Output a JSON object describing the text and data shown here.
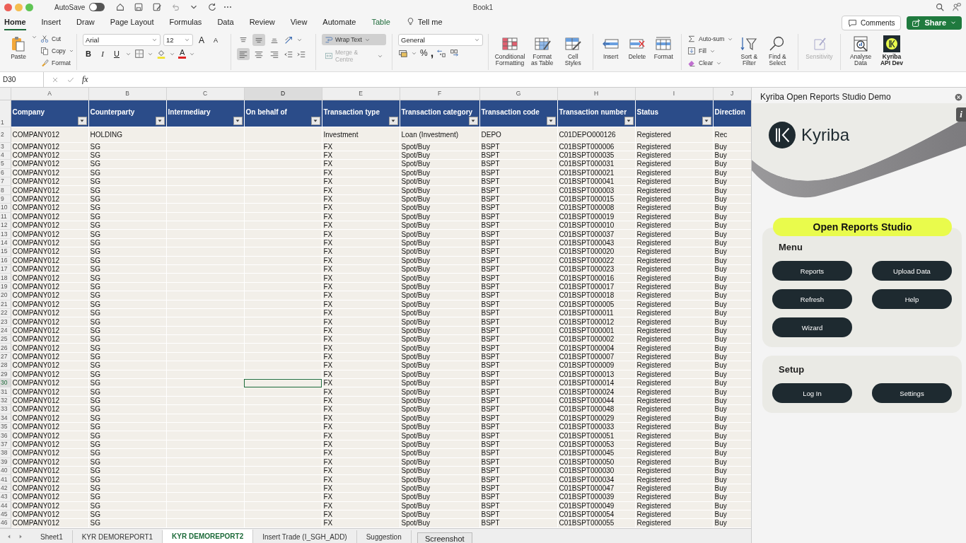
{
  "title_bar": {
    "autosave_label": "AutoSave",
    "autosave_on": false,
    "more": "⋯",
    "title": "Book1"
  },
  "ribbon_tabs": [
    {
      "label": "Home",
      "selected": true,
      "kind": "tab"
    },
    {
      "label": "Insert",
      "selected": false,
      "kind": "tab"
    },
    {
      "label": "Draw",
      "selected": false,
      "kind": "tab"
    },
    {
      "label": "Page Layout",
      "selected": false,
      "kind": "tab"
    },
    {
      "label": "Formulas",
      "selected": false,
      "kind": "tab"
    },
    {
      "label": "Data",
      "selected": false,
      "kind": "tab"
    },
    {
      "label": "Review",
      "selected": false,
      "kind": "tab"
    },
    {
      "label": "View",
      "selected": false,
      "kind": "tab"
    },
    {
      "label": "Automate",
      "selected": false,
      "kind": "tab"
    },
    {
      "label": "Table",
      "selected": false,
      "kind": "contextual"
    },
    {
      "label": "Tell me",
      "selected": false,
      "kind": "search"
    }
  ],
  "comments_button": "Comments",
  "share_button": "Share",
  "ribbon": {
    "clipboard": {
      "paste": "Paste",
      "items": [
        {
          "label": "Cut",
          "kind": "cut",
          "menu": false
        },
        {
          "label": "Copy",
          "kind": "copy",
          "menu": true
        },
        {
          "label": "Format",
          "kind": "brush",
          "menu": false
        }
      ]
    },
    "font": {
      "name": "Arial",
      "size": "12",
      "grow": "A",
      "shrink": "A",
      "styles": [
        "B",
        "I",
        "U"
      ],
      "color_letter": "A"
    },
    "alignment": {
      "vertical": [
        {
          "kind": "top",
          "selected": false
        },
        {
          "kind": "middle",
          "selected": true
        },
        {
          "kind": "bottom",
          "selected": false
        }
      ],
      "horizontal": [
        {
          "kind": "left",
          "selected": true
        },
        {
          "kind": "center",
          "selected": false
        },
        {
          "kind": "right",
          "selected": false
        }
      ]
    },
    "wrap": {
      "label": "Wrap Text",
      "on": true
    },
    "merge": {
      "label": "Merge & Centre",
      "disabled": true
    },
    "number": {
      "format": "General",
      "percent": "%",
      "comma": ","
    },
    "styles": [
      {
        "label": "Conditional\nFormatting",
        "kind": "conditional"
      },
      {
        "label": "Format\nas Table",
        "kind": "table"
      },
      {
        "label": "Cell\nStyles",
        "kind": "cellstyles"
      }
    ],
    "cells": [
      {
        "label": "Insert",
        "kind": "insert"
      },
      {
        "label": "Delete",
        "kind": "delete"
      },
      {
        "label": "Format",
        "kind": "formatcells"
      }
    ],
    "editing_small": [
      {
        "label": "Auto-sum",
        "kind": "sum"
      },
      {
        "label": "Fill",
        "kind": "filldown"
      },
      {
        "label": "Clear",
        "kind": "eraser"
      }
    ],
    "editing_big": [
      {
        "label": "Sort &\nFilter",
        "kind": "sort"
      },
      {
        "label": "Find &\nSelect",
        "kind": "find"
      }
    ],
    "sensitivity": {
      "label": "Sensitivity",
      "disabled": true
    },
    "addins": [
      {
        "label": "Analyse\nData",
        "kind": "analyse"
      },
      {
        "label": "Kyriba\nAPI Dev",
        "kind": "kyriba"
      }
    ]
  },
  "formula_bar": {
    "name_box": "D30",
    "fx": "fx"
  },
  "sheet": {
    "header_row_number": "1",
    "columns": [
      {
        "letter": "A",
        "label": "Company",
        "selected": false,
        "filter_button": true
      },
      {
        "letter": "B",
        "label": "Counterparty",
        "selected": false,
        "filter_button": true
      },
      {
        "letter": "C",
        "label": "Intermediary",
        "selected": false,
        "filter_button": true
      },
      {
        "letter": "D",
        "label": "On behalf of",
        "selected": true,
        "filter_button": true
      },
      {
        "letter": "E",
        "label": "Transaction type",
        "selected": false,
        "filter_button": true
      },
      {
        "letter": "F",
        "label": "Transaction category",
        "selected": false,
        "filter_button": true
      },
      {
        "letter": "G",
        "label": "Transaction code",
        "selected": false,
        "filter_button": true
      },
      {
        "letter": "H",
        "label": "Transaction number",
        "selected": false,
        "filter_button": true
      },
      {
        "letter": "I",
        "label": "Status",
        "selected": false,
        "filter_button": true
      },
      {
        "letter": "J",
        "label": "Direction",
        "selected": false,
        "filter_button": false
      }
    ],
    "rows": [
      {
        "number": "2",
        "selected": false,
        "cells": [
          "COMPANY012",
          "HOLDING",
          null,
          null,
          "Investment",
          "Loan (Investment)",
          "DEPO",
          "C01DEPO000126",
          "Registered",
          "Rec"
        ]
      },
      {
        "number": "3",
        "selected": false,
        "cells": [
          "COMPANY012",
          "SG",
          null,
          null,
          "FX",
          "Spot/Buy",
          "BSPT",
          "C01BSPT000006",
          "Registered",
          "Buy"
        ]
      },
      {
        "number": "4",
        "selected": false,
        "cells": [
          "COMPANY012",
          "SG",
          null,
          null,
          "FX",
          "Spot/Buy",
          "BSPT",
          "C01BSPT000035",
          "Registered",
          "Buy"
        ]
      },
      {
        "number": "5",
        "selected": false,
        "cells": [
          "COMPANY012",
          "SG",
          null,
          null,
          "FX",
          "Spot/Buy",
          "BSPT",
          "C01BSPT000031",
          "Registered",
          "Buy"
        ]
      },
      {
        "number": "6",
        "selected": false,
        "cells": [
          "COMPANY012",
          "SG",
          null,
          null,
          "FX",
          "Spot/Buy",
          "BSPT",
          "C01BSPT000021",
          "Registered",
          "Buy"
        ]
      },
      {
        "number": "7",
        "selected": false,
        "cells": [
          "COMPANY012",
          "SG",
          null,
          null,
          "FX",
          "Spot/Buy",
          "BSPT",
          "C01BSPT000041",
          "Registered",
          "Buy"
        ]
      },
      {
        "number": "8",
        "selected": false,
        "cells": [
          "COMPANY012",
          "SG",
          null,
          null,
          "FX",
          "Spot/Buy",
          "BSPT",
          "C01BSPT000003",
          "Registered",
          "Buy"
        ]
      },
      {
        "number": "9",
        "selected": false,
        "cells": [
          "COMPANY012",
          "SG",
          null,
          null,
          "FX",
          "Spot/Buy",
          "BSPT",
          "C01BSPT000015",
          "Registered",
          "Buy"
        ]
      },
      {
        "number": "10",
        "selected": false,
        "cells": [
          "COMPANY012",
          "SG",
          null,
          null,
          "FX",
          "Spot/Buy",
          "BSPT",
          "C01BSPT000008",
          "Registered",
          "Buy"
        ]
      },
      {
        "number": "11",
        "selected": false,
        "cells": [
          "COMPANY012",
          "SG",
          null,
          null,
          "FX",
          "Spot/Buy",
          "BSPT",
          "C01BSPT000019",
          "Registered",
          "Buy"
        ]
      },
      {
        "number": "12",
        "selected": false,
        "cells": [
          "COMPANY012",
          "SG",
          null,
          null,
          "FX",
          "Spot/Buy",
          "BSPT",
          "C01BSPT000010",
          "Registered",
          "Buy"
        ]
      },
      {
        "number": "13",
        "selected": false,
        "cells": [
          "COMPANY012",
          "SG",
          null,
          null,
          "FX",
          "Spot/Buy",
          "BSPT",
          "C01BSPT000037",
          "Registered",
          "Buy"
        ]
      },
      {
        "number": "14",
        "selected": false,
        "cells": [
          "COMPANY012",
          "SG",
          null,
          null,
          "FX",
          "Spot/Buy",
          "BSPT",
          "C01BSPT000043",
          "Registered",
          "Buy"
        ]
      },
      {
        "number": "15",
        "selected": false,
        "cells": [
          "COMPANY012",
          "SG",
          null,
          null,
          "FX",
          "Spot/Buy",
          "BSPT",
          "C01BSPT000020",
          "Registered",
          "Buy"
        ]
      },
      {
        "number": "16",
        "selected": false,
        "cells": [
          "COMPANY012",
          "SG",
          null,
          null,
          "FX",
          "Spot/Buy",
          "BSPT",
          "C01BSPT000022",
          "Registered",
          "Buy"
        ]
      },
      {
        "number": "17",
        "selected": false,
        "cells": [
          "COMPANY012",
          "SG",
          null,
          null,
          "FX",
          "Spot/Buy",
          "BSPT",
          "C01BSPT000023",
          "Registered",
          "Buy"
        ]
      },
      {
        "number": "18",
        "selected": false,
        "cells": [
          "COMPANY012",
          "SG",
          null,
          null,
          "FX",
          "Spot/Buy",
          "BSPT",
          "C01BSPT000016",
          "Registered",
          "Buy"
        ]
      },
      {
        "number": "19",
        "selected": false,
        "cells": [
          "COMPANY012",
          "SG",
          null,
          null,
          "FX",
          "Spot/Buy",
          "BSPT",
          "C01BSPT000017",
          "Registered",
          "Buy"
        ]
      },
      {
        "number": "20",
        "selected": false,
        "cells": [
          "COMPANY012",
          "SG",
          null,
          null,
          "FX",
          "Spot/Buy",
          "BSPT",
          "C01BSPT000018",
          "Registered",
          "Buy"
        ]
      },
      {
        "number": "21",
        "selected": false,
        "cells": [
          "COMPANY012",
          "SG",
          null,
          null,
          "FX",
          "Spot/Buy",
          "BSPT",
          "C01BSPT000005",
          "Registered",
          "Buy"
        ]
      },
      {
        "number": "22",
        "selected": false,
        "cells": [
          "COMPANY012",
          "SG",
          null,
          null,
          "FX",
          "Spot/Buy",
          "BSPT",
          "C01BSPT000011",
          "Registered",
          "Buy"
        ]
      },
      {
        "number": "23",
        "selected": false,
        "cells": [
          "COMPANY012",
          "SG",
          null,
          null,
          "FX",
          "Spot/Buy",
          "BSPT",
          "C01BSPT000012",
          "Registered",
          "Buy"
        ]
      },
      {
        "number": "24",
        "selected": false,
        "cells": [
          "COMPANY012",
          "SG",
          null,
          null,
          "FX",
          "Spot/Buy",
          "BSPT",
          "C01BSPT000001",
          "Registered",
          "Buy"
        ]
      },
      {
        "number": "25",
        "selected": false,
        "cells": [
          "COMPANY012",
          "SG",
          null,
          null,
          "FX",
          "Spot/Buy",
          "BSPT",
          "C01BSPT000002",
          "Registered",
          "Buy"
        ]
      },
      {
        "number": "26",
        "selected": false,
        "cells": [
          "COMPANY012",
          "SG",
          null,
          null,
          "FX",
          "Spot/Buy",
          "BSPT",
          "C01BSPT000004",
          "Registered",
          "Buy"
        ]
      },
      {
        "number": "27",
        "selected": false,
        "cells": [
          "COMPANY012",
          "SG",
          null,
          null,
          "FX",
          "Spot/Buy",
          "BSPT",
          "C01BSPT000007",
          "Registered",
          "Buy"
        ]
      },
      {
        "number": "28",
        "selected": false,
        "cells": [
          "COMPANY012",
          "SG",
          null,
          null,
          "FX",
          "Spot/Buy",
          "BSPT",
          "C01BSPT000009",
          "Registered",
          "Buy"
        ]
      },
      {
        "number": "29",
        "selected": false,
        "cells": [
          "COMPANY012",
          "SG",
          null,
          null,
          "FX",
          "Spot/Buy",
          "BSPT",
          "C01BSPT000013",
          "Registered",
          "Buy"
        ]
      },
      {
        "number": "30",
        "selected": true,
        "cells": [
          "COMPANY012",
          "SG",
          null,
          null,
          "FX",
          "Spot/Buy",
          "BSPT",
          "C01BSPT000014",
          "Registered",
          "Buy"
        ]
      },
      {
        "number": "31",
        "selected": false,
        "cells": [
          "COMPANY012",
          "SG",
          null,
          null,
          "FX",
          "Spot/Buy",
          "BSPT",
          "C01BSPT000024",
          "Registered",
          "Buy"
        ]
      },
      {
        "number": "32",
        "selected": false,
        "cells": [
          "COMPANY012",
          "SG",
          null,
          null,
          "FX",
          "Spot/Buy",
          "BSPT",
          "C01BSPT000044",
          "Registered",
          "Buy"
        ]
      },
      {
        "number": "33",
        "selected": false,
        "cells": [
          "COMPANY012",
          "SG",
          null,
          null,
          "FX",
          "Spot/Buy",
          "BSPT",
          "C01BSPT000048",
          "Registered",
          "Buy"
        ]
      },
      {
        "number": "34",
        "selected": false,
        "cells": [
          "COMPANY012",
          "SG",
          null,
          null,
          "FX",
          "Spot/Buy",
          "BSPT",
          "C01BSPT000029",
          "Registered",
          "Buy"
        ]
      },
      {
        "number": "35",
        "selected": false,
        "cells": [
          "COMPANY012",
          "SG",
          null,
          null,
          "FX",
          "Spot/Buy",
          "BSPT",
          "C01BSPT000033",
          "Registered",
          "Buy"
        ]
      },
      {
        "number": "36",
        "selected": false,
        "cells": [
          "COMPANY012",
          "SG",
          null,
          null,
          "FX",
          "Spot/Buy",
          "BSPT",
          "C01BSPT000051",
          "Registered",
          "Buy"
        ]
      },
      {
        "number": "37",
        "selected": false,
        "cells": [
          "COMPANY012",
          "SG",
          null,
          null,
          "FX",
          "Spot/Buy",
          "BSPT",
          "C01BSPT000053",
          "Registered",
          "Buy"
        ]
      },
      {
        "number": "38",
        "selected": false,
        "cells": [
          "COMPANY012",
          "SG",
          null,
          null,
          "FX",
          "Spot/Buy",
          "BSPT",
          "C01BSPT000045",
          "Registered",
          "Buy"
        ]
      },
      {
        "number": "39",
        "selected": false,
        "cells": [
          "COMPANY012",
          "SG",
          null,
          null,
          "FX",
          "Spot/Buy",
          "BSPT",
          "C01BSPT000050",
          "Registered",
          "Buy"
        ]
      },
      {
        "number": "40",
        "selected": false,
        "cells": [
          "COMPANY012",
          "SG",
          null,
          null,
          "FX",
          "Spot/Buy",
          "BSPT",
          "C01BSPT000030",
          "Registered",
          "Buy"
        ]
      },
      {
        "number": "41",
        "selected": false,
        "cells": [
          "COMPANY012",
          "SG",
          null,
          null,
          "FX",
          "Spot/Buy",
          "BSPT",
          "C01BSPT000034",
          "Registered",
          "Buy"
        ]
      },
      {
        "number": "42",
        "selected": false,
        "cells": [
          "COMPANY012",
          "SG",
          null,
          null,
          "FX",
          "Spot/Buy",
          "BSPT",
          "C01BSPT000047",
          "Registered",
          "Buy"
        ]
      },
      {
        "number": "43",
        "selected": false,
        "cells": [
          "COMPANY012",
          "SG",
          null,
          null,
          "FX",
          "Spot/Buy",
          "BSPT",
          "C01BSPT000039",
          "Registered",
          "Buy"
        ]
      },
      {
        "number": "44",
        "selected": false,
        "cells": [
          "COMPANY012",
          "SG",
          null,
          null,
          "FX",
          "Spot/Buy",
          "BSPT",
          "C01BSPT000049",
          "Registered",
          "Buy"
        ]
      },
      {
        "number": "45",
        "selected": false,
        "cells": [
          "COMPANY012",
          "SG",
          null,
          null,
          "FX",
          "Spot/Buy",
          "BSPT",
          "C01BSPT000054",
          "Registered",
          "Buy"
        ]
      },
      {
        "number": "46",
        "selected": false,
        "cells": [
          "COMPANY012",
          "SG",
          null,
          null,
          "FX",
          "Spot/Buy",
          "BSPT",
          "C01BSPT000055",
          "Registered",
          "Buy"
        ]
      }
    ]
  },
  "sheet_tabs": [
    {
      "label": "Sheet1",
      "selected": false
    },
    {
      "label": "KYR DEMOREPORT1",
      "selected": false
    },
    {
      "label": "KYR DEMOREPORT2",
      "selected": true
    },
    {
      "label": "Insert Trade (I_SGH_ADD)",
      "selected": false
    },
    {
      "label": "Suggestion",
      "selected": false
    }
  ],
  "tooltip": "Screenshot",
  "task_pane": {
    "title": "Kyriba Open Reports Studio Demo",
    "info": "i",
    "logo_text": "Kyriba",
    "banner": "Open Reports Studio",
    "sections": [
      {
        "title": "Menu",
        "buttons": [
          "Reports",
          "Upload Data",
          "Refresh",
          "Help",
          "Wizard"
        ]
      },
      {
        "title": "Setup",
        "buttons": [
          "Log In",
          "Settings"
        ]
      }
    ]
  }
}
